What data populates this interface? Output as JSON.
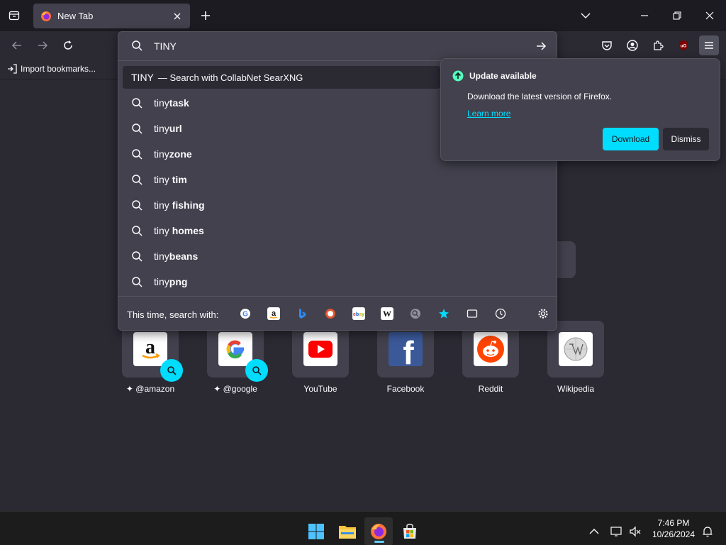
{
  "tab": {
    "title": "New Tab"
  },
  "bookmarks": {
    "import_label": "Import bookmarks..."
  },
  "urlbar": {
    "value": "TINY",
    "suggestions": [
      {
        "plain": "TINY",
        "bold": "",
        "sub": "— Search with CollabNet SearXNG"
      },
      {
        "plain": "tiny",
        "bold": "task"
      },
      {
        "plain": "tiny",
        "bold": "url"
      },
      {
        "plain": "tiny",
        "bold": "zone"
      },
      {
        "plain": "tiny ",
        "bold": "tim"
      },
      {
        "plain": "tiny ",
        "bold": "fishing"
      },
      {
        "plain": "tiny ",
        "bold": "homes"
      },
      {
        "plain": "tiny",
        "bold": "beans"
      },
      {
        "plain": "tiny",
        "bold": "png"
      }
    ],
    "search_with_label": "This time, search with:",
    "engines": [
      "google",
      "amazon",
      "bing",
      "duckduckgo",
      "ebay",
      "wikipedia",
      "searxng",
      "bookmarks",
      "tabs",
      "history"
    ]
  },
  "update": {
    "title": "Update available",
    "message": "Download the latest version of Firefox.",
    "link": "Learn more",
    "download_label": "Download",
    "dismiss_label": "Dismiss"
  },
  "top_sites": [
    {
      "label": "@amazon",
      "pinned": true,
      "search": true
    },
    {
      "label": "@google",
      "pinned": true,
      "search": true
    },
    {
      "label": "YouTube"
    },
    {
      "label": "Facebook"
    },
    {
      "label": "Reddit"
    },
    {
      "label": "Wikipedia"
    }
  ],
  "taskbar": {
    "time": "7:46 PM",
    "date": "10/26/2024"
  },
  "colors": {
    "accent": "#00ddff",
    "panel": "#42414d",
    "bg": "#2b2a33"
  }
}
